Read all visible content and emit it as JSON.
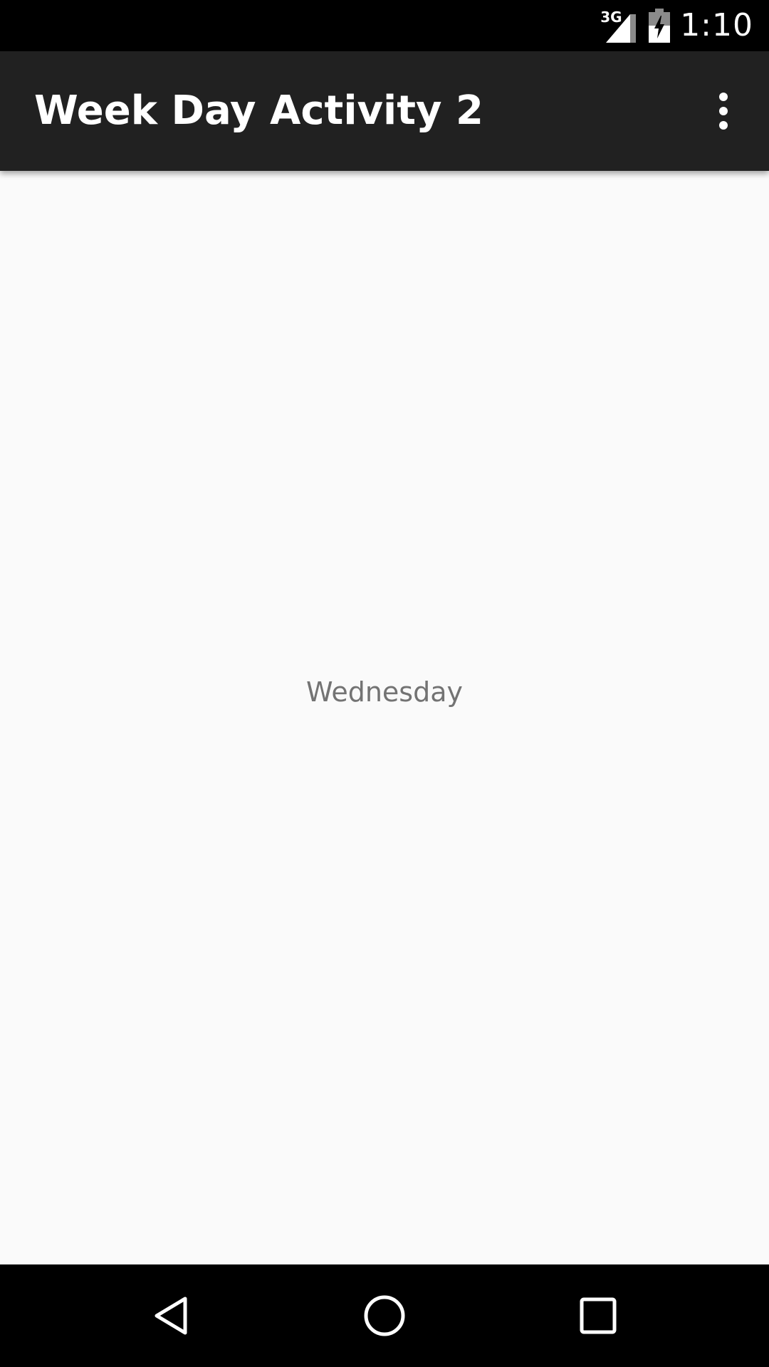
{
  "status_bar": {
    "network_type": "3G",
    "time": "1:10",
    "icons": [
      "signal-icon",
      "battery-charging-icon"
    ]
  },
  "app_bar": {
    "title": "Week Day Activity 2",
    "overflow_icon": "more-vert-icon"
  },
  "content": {
    "day_label": "Wednesday"
  },
  "nav_bar": {
    "icons": [
      "back-icon",
      "home-icon",
      "recents-icon"
    ]
  },
  "colors": {
    "status_bar": "#000000",
    "app_bar": "#212121",
    "background": "#fafafa",
    "day_text": "#737373",
    "nav_bar": "#000000"
  }
}
